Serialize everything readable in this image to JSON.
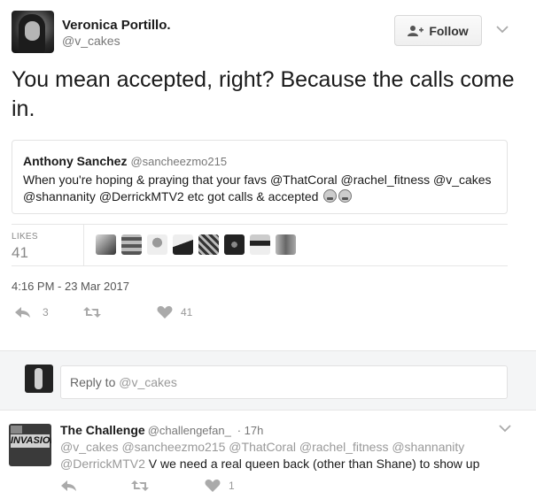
{
  "author": {
    "name": "Veronica Portillo.",
    "handle": "@v_cakes"
  },
  "follow_button": {
    "label": "Follow",
    "icon": "add-person-icon"
  },
  "tweet": {
    "text": "You mean accepted, right?  Because the calls come in."
  },
  "quoted_tweet": {
    "name": "Anthony Sanchez",
    "handle": "@sancheezmo215",
    "text": "When you're hoping & praying that your favs @ThatCoral @rachel_fitness @v_cakes @shannanity @DerrickMTV2 etc got calls & accepted",
    "emojis": [
      "weary-face",
      "weary-face"
    ]
  },
  "stats": {
    "likes_label": "LIKES",
    "likes_count": "41",
    "liker_avatar_count_shown": 8
  },
  "timestamp": "4:16 PM - 23 Mar 2017",
  "actions": {
    "reply_count": "3",
    "retweet_count": "",
    "like_count": "41"
  },
  "reply_box": {
    "prefix": "Reply to ",
    "mention": "@v_cakes"
  },
  "reply_tweet": {
    "name": "The Challenge",
    "handle": "@challengefan_",
    "time": "· 17h",
    "avatar_logo": "INVASION",
    "mentions": "@v_cakes @sancheezmo215 @ThatCoral @rachel_fitness @shannanity @DerrickMTV2",
    "text": "V we need a real queen back (other than Shane) to show up",
    "reply_count": "",
    "retweet_count": "",
    "like_count": "1"
  },
  "colors": {
    "text": "#1a1a1a",
    "muted": "#777777",
    "icon": "#aaaaaa",
    "band": "#f4f5f6"
  }
}
